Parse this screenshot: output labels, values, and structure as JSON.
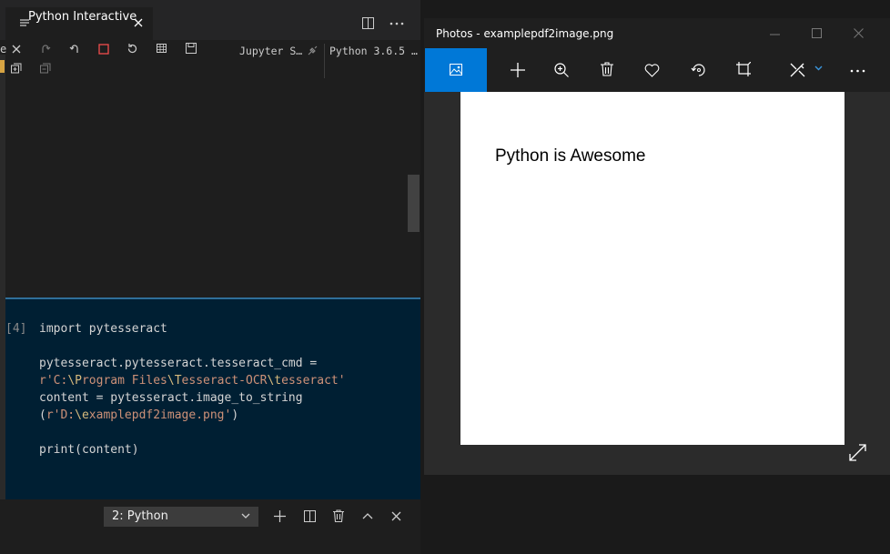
{
  "vscode": {
    "tab": {
      "title": "Python Interactive",
      "menu_icon": "list-icon",
      "close_icon": "close-icon"
    },
    "tab_actions": [
      "split-editor-icon",
      "more-actions-icon"
    ],
    "toolbar": {
      "icons": [
        "close-icon",
        "redo-icon",
        "undo-icon",
        "stop-icon",
        "restart-icon",
        "variables-icon",
        "save-icon",
        "expand-all-icon",
        "collapse-all-icon"
      ],
      "kernel_label": "Jupyter S…",
      "python_label": "Python 3.6.5 …"
    },
    "edge_char": "e",
    "cell": {
      "prompt": "[4]",
      "lines": {
        "l1": "import pytesseract",
        "l2": "pytesseract.pytesseract.tesseract_cmd =",
        "l3_a": "r'C:",
        "l3_b": "\\P",
        "l3_c": "rogram Files",
        "l3_d": "\\T",
        "l3_e": "esseract-OCR",
        "l3_f": "\\t",
        "l3_g": "esseract'",
        "l4": "content = pytesseract.image_to_string",
        "l5_a": "(",
        "l5_b": "r'D:",
        "l5_c": "\\e",
        "l5_d": "xamplepdf2image.png'",
        "l5_e": ")",
        "l6": "print(content)"
      }
    },
    "terminal": {
      "selected": "2: Python",
      "icons": [
        "chevron-down-icon",
        "plus-icon",
        "split-terminal-icon",
        "trash-icon",
        "chevron-up-icon",
        "close-panel-icon"
      ]
    }
  },
  "photos": {
    "title": "Photos - examplepdf2image.png",
    "window_controls": [
      "minimize-icon",
      "maximize-icon",
      "close-window-icon"
    ],
    "toolbar_icons": [
      "view-image-icon",
      "add-icon",
      "zoom-icon",
      "delete-icon",
      "favorite-icon",
      "rotate-icon",
      "crop-icon",
      "edit-icon",
      "more-icon"
    ],
    "image_text": "Python is Awesome",
    "accent": "#0078d7",
    "fullscreen_icon": "expand-icon"
  }
}
